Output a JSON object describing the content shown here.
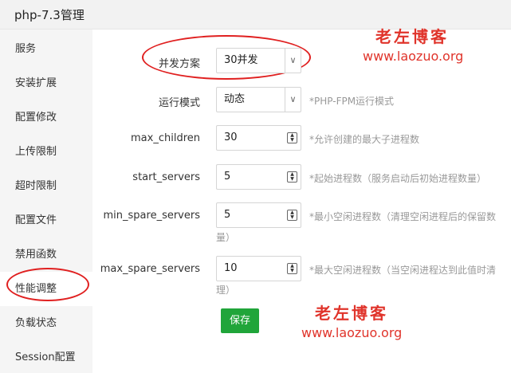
{
  "window": {
    "title": "php-7.3管理"
  },
  "sidebar": {
    "items": [
      {
        "label": "服务"
      },
      {
        "label": "安装扩展"
      },
      {
        "label": "配置修改"
      },
      {
        "label": "上传限制"
      },
      {
        "label": "超时限制"
      },
      {
        "label": "配置文件"
      },
      {
        "label": "禁用函数"
      },
      {
        "label": "性能调整"
      },
      {
        "label": "负载状态"
      },
      {
        "label": "Session配置"
      }
    ],
    "active": "性能调整"
  },
  "form": {
    "concurrency": {
      "label": "并发方案",
      "value": "30并发"
    },
    "run_mode": {
      "label": "运行模式",
      "value": "动态",
      "hint": "*PHP-FPM运行模式"
    },
    "max_children": {
      "label": "max_children",
      "value": "30",
      "hint": "*允许创建的最大子进程数"
    },
    "start_servers": {
      "label": "start_servers",
      "value": "5",
      "hint": "*起始进程数（服务启动后初始进程数量）"
    },
    "min_spare_servers": {
      "label": "min_spare_servers",
      "value": "5",
      "hint_line1": "*最小空闲进程数（清理空闲进程后的保留数",
      "hint_line2": "量）"
    },
    "max_spare_servers": {
      "label": "max_spare_servers",
      "value": "10",
      "hint_line1": "*最大空闲进程数（当空闲进程达到此值时清",
      "hint_line2": "理）"
    },
    "save_label": "保存"
  },
  "watermark": {
    "title": "老左博客",
    "url": "www.laozuo.org"
  },
  "colors": {
    "accent_green": "#20a53a",
    "annotation_red": "#e02020",
    "watermark_red": "#e0342b"
  }
}
